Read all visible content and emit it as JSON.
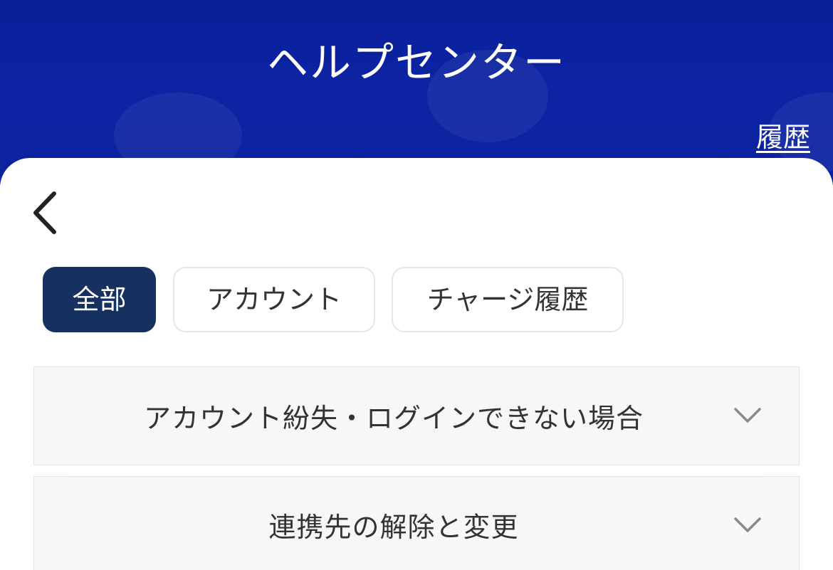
{
  "header": {
    "title": "ヘルプセンター",
    "history_link": "履歴",
    "background_color": "#0b22a0"
  },
  "nav": {
    "back_icon": "chevron-left-icon"
  },
  "tabs": [
    {
      "label": "全部",
      "active": true
    },
    {
      "label": "アカウント",
      "active": false
    },
    {
      "label": "チャージ履歴",
      "active": false
    }
  ],
  "faq": {
    "items": [
      {
        "question": "アカウント紛失・ログインできない場合",
        "icon": "chevron-down-icon"
      },
      {
        "question": "連携先の解除と変更",
        "icon": "chevron-down-icon"
      }
    ]
  },
  "colors": {
    "active_tab": "#16305f",
    "item_background": "#f7f7f7"
  }
}
